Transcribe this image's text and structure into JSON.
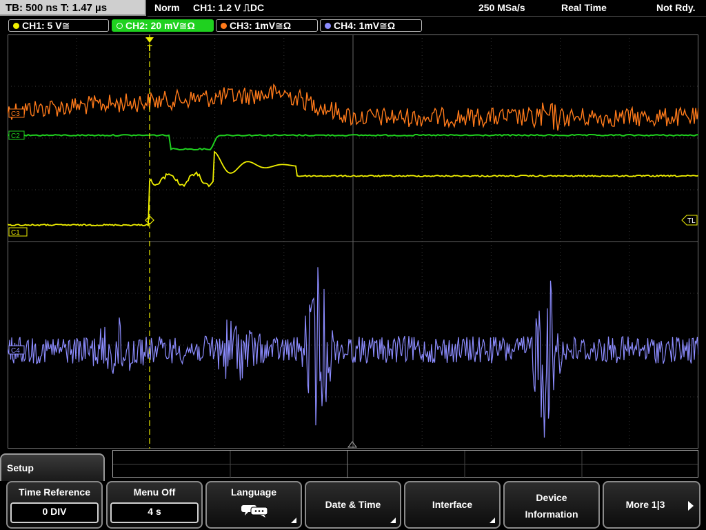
{
  "topbar": {
    "timebase": "TB: 500 ns   T: 1.47 µs",
    "mode": "Norm",
    "trigger": "CH1: 1.2 V ⎍DC",
    "sample_rate": "250 MSa/s",
    "acq_mode": "Real Time",
    "status": "Not Rdy."
  },
  "channels": [
    {
      "label": "CH1: 5 V≅",
      "color": "#f0f000",
      "active": false
    },
    {
      "label": "CH2: 20 mV≅Ω",
      "color": "#1fd11f",
      "active": true
    },
    {
      "label": "CH3: 1mV≅Ω",
      "color": "#ff7a1a",
      "active": false
    },
    {
      "label": "CH4: 1mV≅Ω",
      "color": "#8c8cff",
      "active": false
    }
  ],
  "markers": {
    "ch1": "C1",
    "ch2": "C2",
    "ch3": "C3",
    "ch4": "C4",
    "trigger_level": "TL"
  },
  "menu": {
    "title": "Setup",
    "softkeys": [
      {
        "label": "Time Reference",
        "value": "0 DIV"
      },
      {
        "label": "Menu Off",
        "value": "4 s"
      },
      {
        "label": "Language",
        "icon": "speech-bubble-icon"
      },
      {
        "label": "Date & Time"
      },
      {
        "label": "Interface"
      },
      {
        "label_line1": "Device",
        "label_line2": "Information"
      },
      {
        "label": "More 1|3"
      }
    ]
  }
}
